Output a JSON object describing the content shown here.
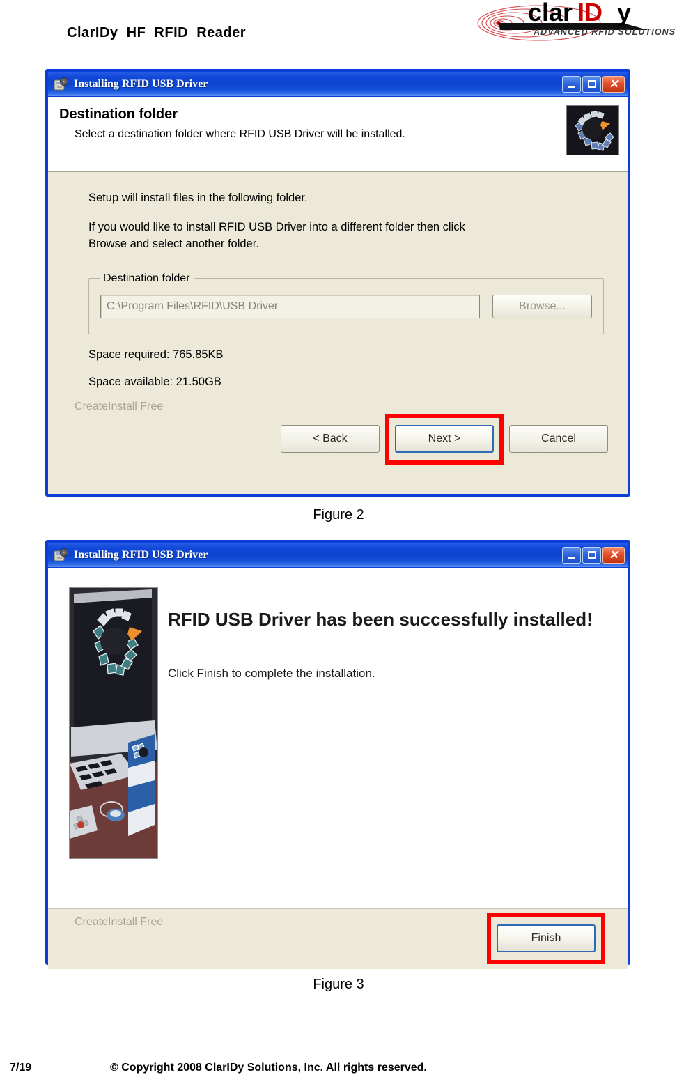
{
  "document": {
    "title": "ClarIDy  HF  RFID  Reader",
    "logo": {
      "brand_part1": "clar",
      "brand_part2": "ID",
      "brand_part3": "y",
      "tagline": "ADVANCED RFID SOLUTIONS",
      "brand_color_black": "#000000",
      "brand_color_red": "#CC0000",
      "swirl_color": "#D4484C"
    },
    "footer": {
      "page_number": "7/19",
      "copyright": "© Copyright 2008 ClarIDy Solutions, Inc. All rights reserved."
    }
  },
  "figure2": {
    "caption": "Figure 2",
    "dialog": {
      "title": "Installing RFID USB Driver",
      "window_buttons": {
        "minimize": "minimize-button",
        "maximize": "maximize-button",
        "close": "close-button"
      },
      "header": {
        "title": "Destination folder",
        "subtitle": "Select a destination folder where RFID USB Driver will be installed."
      },
      "body": {
        "line1": "Setup will install files in the following folder.",
        "line2": "If you would like to install RFID USB Driver into a different folder then click",
        "line3": "Browse and select another folder.",
        "group_legend": "Destination folder",
        "path_value": "C:\\Program Files\\RFID\\USB Driver",
        "browse_label": "Browse...",
        "space_required": "Space required: 765.85KB",
        "space_available": "Space available: 21.50GB"
      },
      "footer": {
        "branding": "CreateInstall Free",
        "back_label": "< Back",
        "next_label": "Next >",
        "cancel_label": "Cancel",
        "highlight_color": "#FF0000",
        "highlighted_button": "Next >"
      }
    }
  },
  "figure3": {
    "caption": "Figure 3",
    "dialog": {
      "title": "Installing RFID USB Driver",
      "window_buttons": {
        "minimize": "minimize-button",
        "maximize": "maximize-button",
        "close": "close-button"
      },
      "body": {
        "heading": "RFID USB Driver has been successfully installed!",
        "subtext": "Click Finish to complete the installation."
      },
      "footer": {
        "branding": "CreateInstall Free",
        "finish_label": "Finish",
        "highlight_color": "#FF0000",
        "highlighted_button": "Finish"
      }
    }
  },
  "theme": {
    "titlebar_blue": "#0D44D0",
    "dialog_face": "#ECE9D8",
    "dialog_border": "#0B3FD6",
    "close_red": "#E2502A"
  }
}
